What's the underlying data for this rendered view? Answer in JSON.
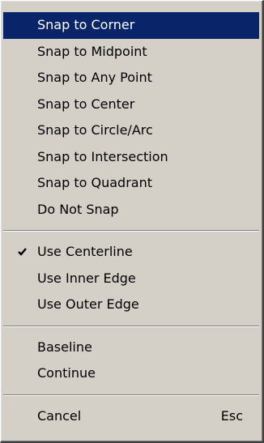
{
  "menu": {
    "group1": [
      {
        "label": "Snap to Corner"
      },
      {
        "label": "Snap to Midpoint"
      },
      {
        "label": "Snap to Any Point"
      },
      {
        "label": "Snap to Center"
      },
      {
        "label": "Snap to Circle/Arc"
      },
      {
        "label": "Snap to Intersection"
      },
      {
        "label": "Snap to Quadrant"
      },
      {
        "label": "Do Not Snap"
      }
    ],
    "group2": [
      {
        "label": "Use Centerline",
        "checked": true
      },
      {
        "label": "Use Inner Edge"
      },
      {
        "label": "Use Outer Edge"
      }
    ],
    "group3": [
      {
        "label": "Baseline"
      },
      {
        "label": "Continue"
      }
    ],
    "group4": [
      {
        "label": "Cancel",
        "shortcut": "Esc"
      }
    ],
    "highlighted_item": "Snap to Corner",
    "highlight_color": "#0a246a",
    "background_color": "#d4d0c8"
  }
}
